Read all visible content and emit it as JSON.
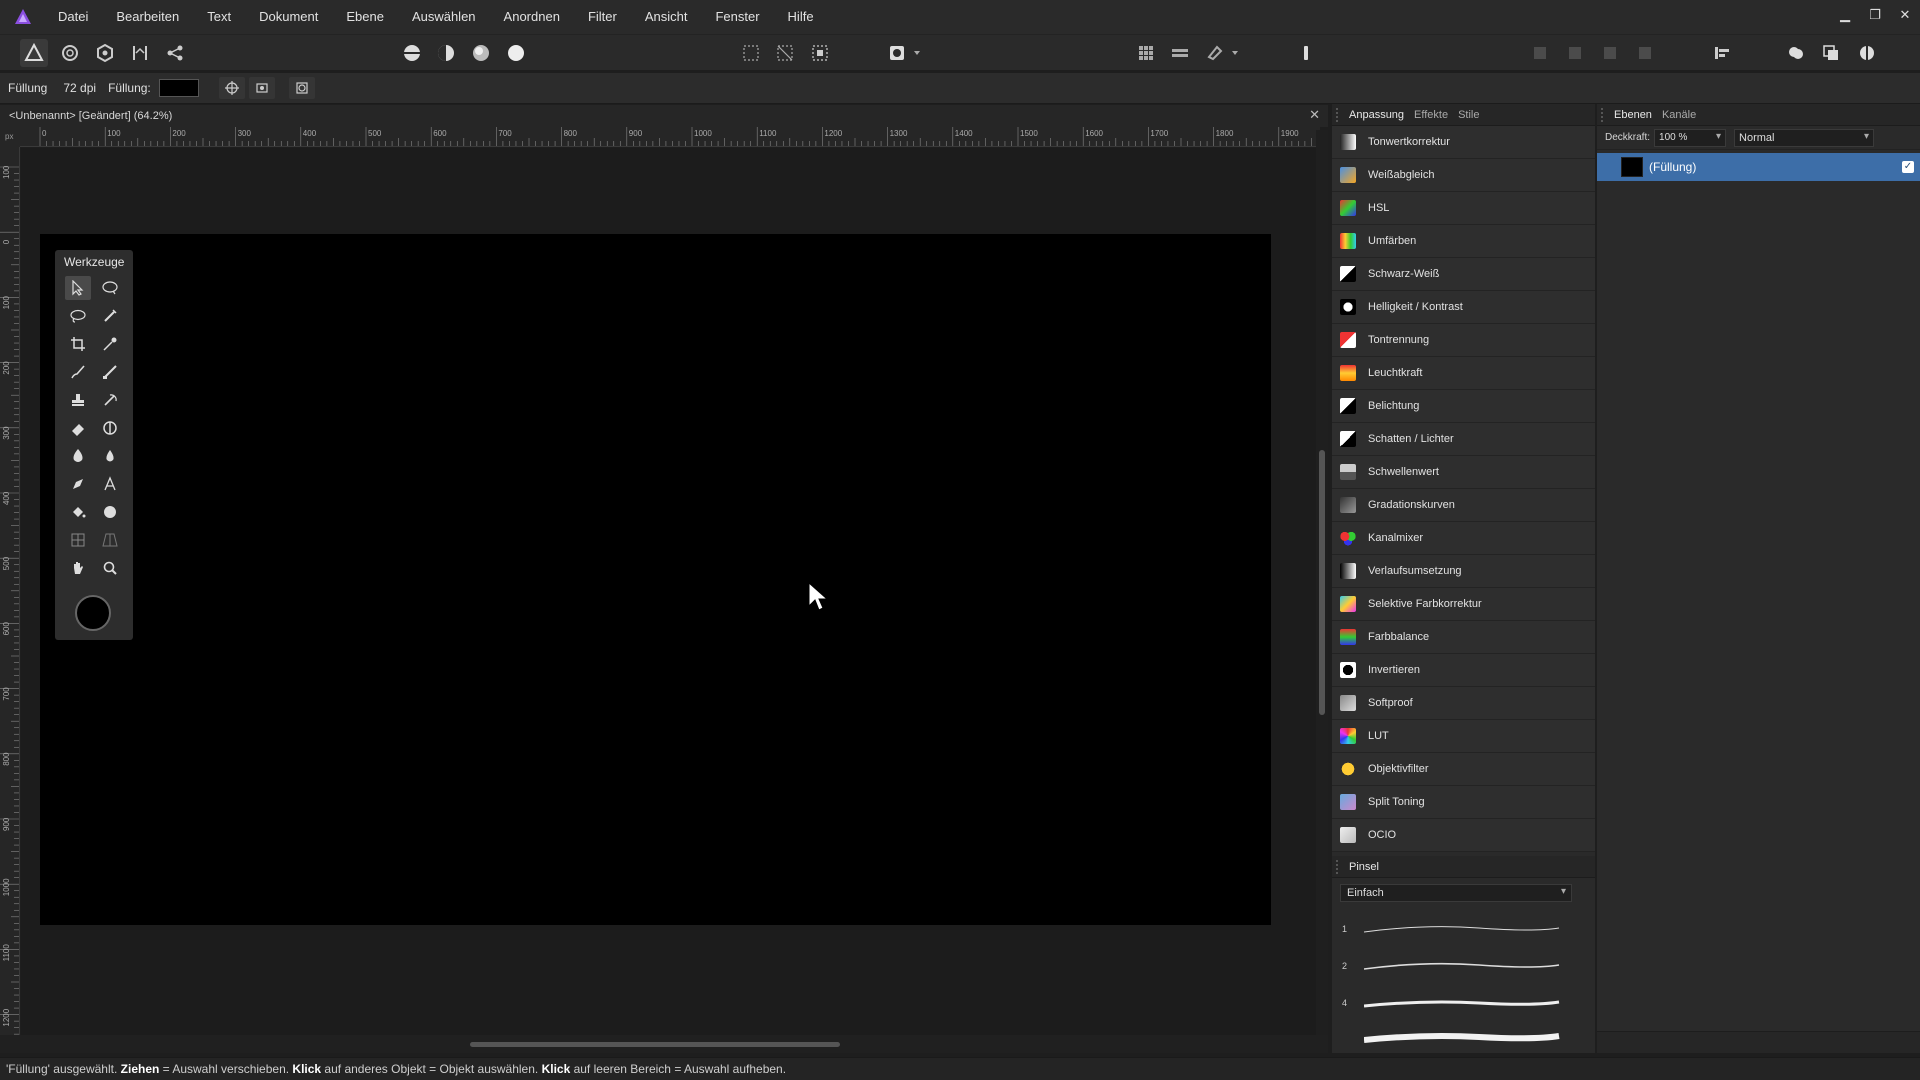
{
  "menu": {
    "items": [
      "Datei",
      "Bearbeiten",
      "Text",
      "Dokument",
      "Ebene",
      "Auswählen",
      "Anordnen",
      "Filter",
      "Ansicht",
      "Fenster",
      "Hilfe"
    ]
  },
  "context": {
    "tool_name": "Füllung",
    "dpi": "72 dpi",
    "fill_label": "Füllung:",
    "fill_color": "#000000"
  },
  "document": {
    "title": "<Unbenannt> [Geändert] (64.2%)",
    "close_glyph": "✕"
  },
  "rulers": {
    "unit": "px",
    "h_ticks": [
      "0",
      "100",
      "200",
      "300",
      "400",
      "500",
      "600",
      "700",
      "800",
      "900",
      "1000",
      "1100",
      "1200",
      "1300",
      "1400",
      "1500",
      "1600",
      "1700",
      "1800",
      "1900"
    ],
    "v_ticks": [
      "100",
      "0",
      "100",
      "200",
      "300",
      "400",
      "500",
      "600",
      "700",
      "800",
      "900",
      "1000",
      "1100",
      "1200"
    ]
  },
  "tools": {
    "title": "Werkzeuge"
  },
  "adjustments": {
    "tabs": [
      "Anpassung",
      "Effekte",
      "Stile"
    ],
    "items": [
      {
        "label": "Tonwertkorrektur",
        "icon": "levels-icon"
      },
      {
        "label": "Weißabgleich",
        "icon": "white-balance-icon"
      },
      {
        "label": "HSL",
        "icon": "hsl-icon"
      },
      {
        "label": "Umfärben",
        "icon": "recolor-icon"
      },
      {
        "label": "Schwarz-Weiß",
        "icon": "black-white-icon"
      },
      {
        "label": "Helligkeit / Kontrast",
        "icon": "brightness-contrast-icon"
      },
      {
        "label": "Tontrennung",
        "icon": "posterize-icon"
      },
      {
        "label": "Leuchtkraft",
        "icon": "vibrance-icon"
      },
      {
        "label": "Belichtung",
        "icon": "exposure-icon"
      },
      {
        "label": "Schatten / Lichter",
        "icon": "shadows-highlights-icon"
      },
      {
        "label": "Schwellenwert",
        "icon": "threshold-icon"
      },
      {
        "label": "Gradationskurven",
        "icon": "curves-icon"
      },
      {
        "label": "Kanalmixer",
        "icon": "channel-mixer-icon"
      },
      {
        "label": "Verlaufsumsetzung",
        "icon": "gradient-map-icon"
      },
      {
        "label": "Selektive Farbkorrektur",
        "icon": "selective-color-icon"
      },
      {
        "label": "Farbbalance",
        "icon": "color-balance-icon"
      },
      {
        "label": "Invertieren",
        "icon": "invert-icon"
      },
      {
        "label": "Softproof",
        "icon": "soft-proof-icon"
      },
      {
        "label": "LUT",
        "icon": "lut-icon"
      },
      {
        "label": "Objektivfilter",
        "icon": "lens-filter-icon"
      },
      {
        "label": "Split Toning",
        "icon": "split-toning-icon"
      },
      {
        "label": "OCIO",
        "icon": "ocio-icon"
      }
    ]
  },
  "brushes": {
    "tab": "Pinsel",
    "category": "Einfach",
    "sizes": [
      "1",
      "2",
      "4",
      ""
    ]
  },
  "layers": {
    "tabs": [
      "Ebenen",
      "Kanäle"
    ],
    "opacity_label": "Deckkraft:",
    "opacity_value": "100 %",
    "blend_mode": "Normal",
    "items": [
      {
        "name": "(Füllung)",
        "visible": true
      }
    ]
  },
  "status": {
    "part1": "'Füllung' ausgewählt. ",
    "b1": "Ziehen",
    "part2": " = Auswahl verschieben. ",
    "b2": "Klick",
    "part3": " auf anderes Objekt = Objekt auswählen. ",
    "b3": "Klick",
    "part4": " auf leeren Bereich = Auswahl aufheben."
  },
  "colors": {
    "accent": "#3d6ea8",
    "app_bg": "#1e1e1e",
    "panel_bg": "#2a2a2a",
    "brand": "#7b3fd4"
  }
}
